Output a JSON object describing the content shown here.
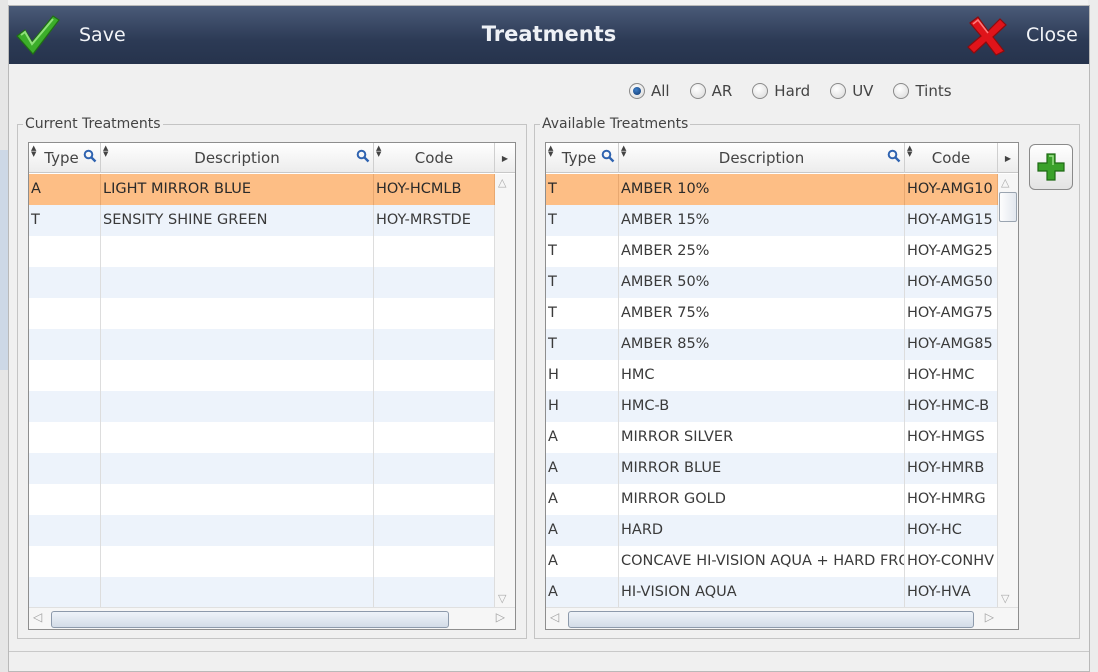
{
  "toolbar": {
    "save_label": "Save",
    "title": "Treatments",
    "close_label": "Close"
  },
  "filters": [
    {
      "label": "All",
      "checked": true
    },
    {
      "label": "AR",
      "checked": false
    },
    {
      "label": "Hard",
      "checked": false
    },
    {
      "label": "UV",
      "checked": false
    },
    {
      "label": "Tints",
      "checked": false
    }
  ],
  "current": {
    "title": "Current Treatments",
    "columns": [
      "Type",
      "Description",
      "Code"
    ],
    "rows": [
      [
        "A",
        "LIGHT MIRROR BLUE",
        "HOY-HCMLB"
      ],
      [
        "T",
        "SENSITY SHINE GREEN",
        "HOY-MRSTDE"
      ]
    ],
    "selected_row": 0,
    "blank_rows": 12
  },
  "available": {
    "title": "Available Treatments",
    "columns": [
      "Type",
      "Description",
      "Code"
    ],
    "rows": [
      [
        "T",
        "AMBER 10%",
        "HOY-AMG10"
      ],
      [
        "T",
        "AMBER 15%",
        "HOY-AMG15"
      ],
      [
        "T",
        "AMBER 25%",
        "HOY-AMG25"
      ],
      [
        "T",
        "AMBER 50%",
        "HOY-AMG50"
      ],
      [
        "T",
        "AMBER 75%",
        "HOY-AMG75"
      ],
      [
        "T",
        "AMBER 85%",
        "HOY-AMG85"
      ],
      [
        "H",
        "HMC",
        "HOY-HMC"
      ],
      [
        "H",
        "HMC-B",
        "HOY-HMC-B"
      ],
      [
        "A",
        "MIRROR SILVER",
        "HOY-HMGS"
      ],
      [
        "A",
        "MIRROR BLUE",
        "HOY-HMRB"
      ],
      [
        "A",
        "MIRROR GOLD",
        "HOY-HMRG"
      ],
      [
        "A",
        "HARD",
        "HOY-HC"
      ],
      [
        "A",
        "CONCAVE HI-VISION AQUA + HARD FRO",
        "HOY-CONHV"
      ],
      [
        "A",
        "HI-VISION AQUA",
        "HOY-HVA"
      ]
    ],
    "selected_row": 0
  },
  "icons": {
    "save": "checkmark-icon",
    "close": "red-x-icon",
    "add": "plus-icon",
    "search": "magnifier-icon"
  },
  "colors": {
    "titlebar": "#2c3a55",
    "selected_row": "#fdbe85",
    "alt_row": "#edf3fb",
    "save_check": "#3cae2a",
    "close_x": "#e0141a",
    "add_plus": "#3aa12a"
  }
}
